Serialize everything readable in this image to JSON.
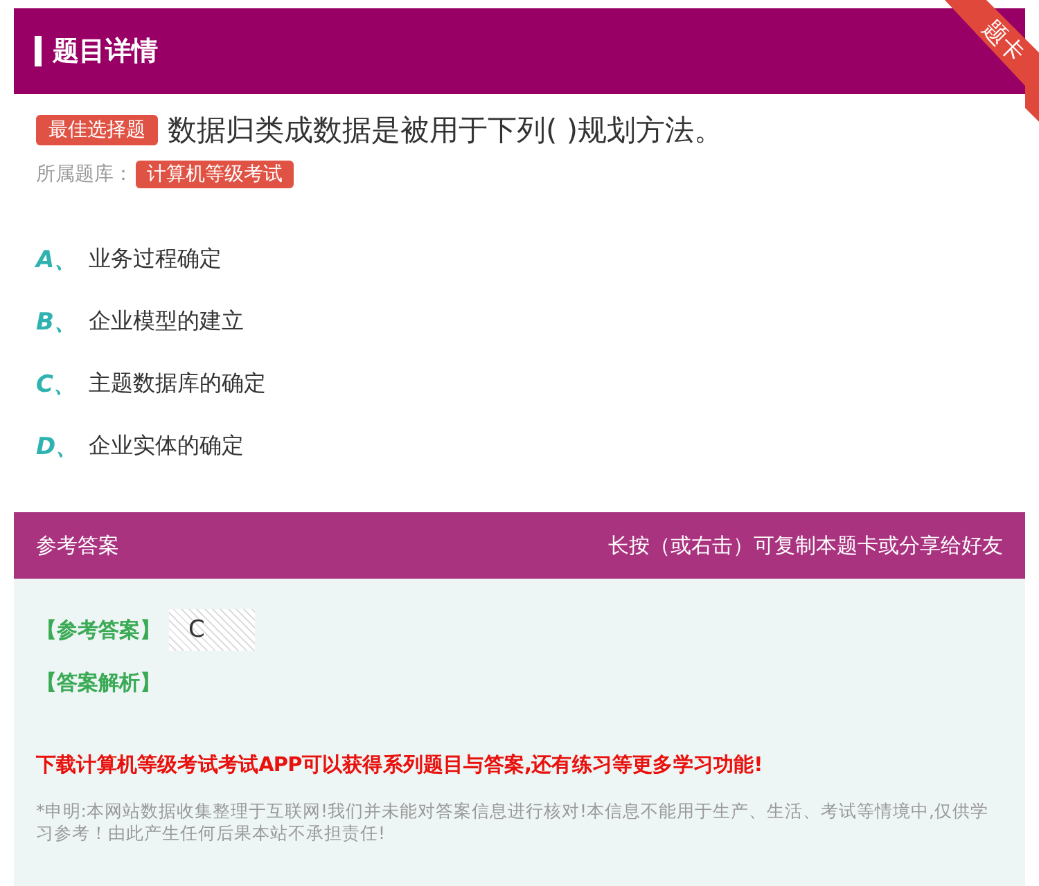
{
  "header": {
    "title": "题目详情",
    "ribbon": "题卡"
  },
  "question": {
    "type_tag": "最佳选择题",
    "text": "数据归类成数据是被用于下列( )规划方法。",
    "bank_label": "所属题库：",
    "bank_tag": "计算机等级考试"
  },
  "options": [
    {
      "letter": "A、",
      "text": "业务过程确定"
    },
    {
      "letter": "B、",
      "text": "企业模型的建立"
    },
    {
      "letter": "C、",
      "text": "主题数据库的确定"
    },
    {
      "letter": "D、",
      "text": "企业实体的确定"
    }
  ],
  "answer_panel": {
    "title": "参考答案",
    "hint": "长按（或右击）可复制本题卡或分享给好友",
    "answer_label": "【参考答案】",
    "answer_value": "C",
    "analysis_label": "【答案解析】",
    "promo": "下载计算机等级考试考试APP可以获得系列题目与答案,还有练习等更多学习功能!",
    "disclaimer": "*申明:本网站数据收集整理于互联网!我们并未能对答案信息进行核对!本信息不能用于生产、生活、考试等情境中,仅供学习参考！由此产生任何后果本站不承担责任!"
  }
}
